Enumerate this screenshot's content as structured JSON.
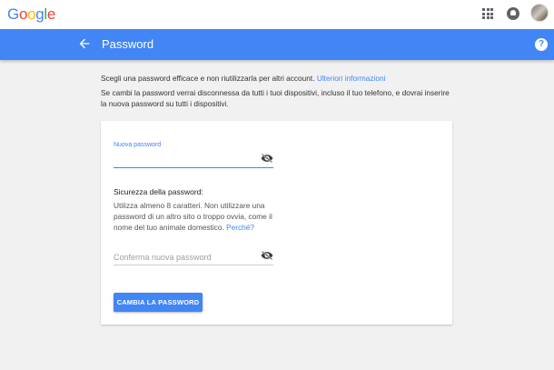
{
  "header": {
    "logo_letters": [
      {
        "char": "G",
        "color": "#4285f4"
      },
      {
        "char": "o",
        "color": "#ea4335"
      },
      {
        "char": "o",
        "color": "#fbbc05"
      },
      {
        "char": "g",
        "color": "#4285f4"
      },
      {
        "char": "l",
        "color": "#34a853"
      },
      {
        "char": "e",
        "color": "#ea4335"
      }
    ],
    "icons": [
      "apps-icon",
      "notifications-icon",
      "avatar"
    ]
  },
  "appbar": {
    "title": "Password",
    "color": "#4285f4",
    "icons": [
      "back-arrow-icon",
      "help-icon"
    ],
    "help_glyph": "?"
  },
  "intro": {
    "line1": "Scegli una password efficace e non riutilizzarla per altri account.",
    "line1_link": "Ulteriori informazioni",
    "line2": "Se cambi la password verrai disconnessa da tutti i tuoi dispositivi, incluso il tuo telefono, e dovrai inserire la nuova password su tutti i dispositivi."
  },
  "form": {
    "new_password_label": "Nuova password",
    "new_password_value": "",
    "strength_title": "Sicurezza della password:",
    "strength_text": "Utilizza almeno 8 caratteri. Non utilizzare una password di un altro sito o troppo ovvia, come il nome del tuo animale domestico.",
    "strength_link": "Perché?",
    "confirm_placeholder": "Conferma nuova password",
    "submit_label": "CAMBIA LA PASSWORD"
  }
}
